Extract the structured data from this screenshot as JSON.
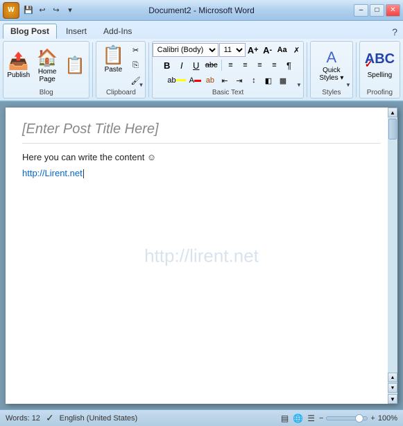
{
  "window": {
    "title": "Document2 - Microsoft Word",
    "min_label": "–",
    "max_label": "□",
    "close_label": "✕"
  },
  "office_btn": {
    "label": "W"
  },
  "quick_access": {
    "save_icon": "💾",
    "undo_icon": "↩",
    "redo_icon": "↪",
    "dropdown_icon": "▾"
  },
  "tabs": [
    {
      "id": "blog-post",
      "label": "Blog Post",
      "active": true
    },
    {
      "id": "insert",
      "label": "Insert",
      "active": false
    },
    {
      "id": "add-ins",
      "label": "Add-Ins",
      "active": false
    }
  ],
  "groups": {
    "blog": {
      "label": "Blog",
      "publish_label": "Publish",
      "home_page_label": "Home\nPage"
    },
    "clipboard": {
      "label": "Clipboard",
      "paste_label": "Paste",
      "cut_icon": "✂",
      "copy_icon": "⎘",
      "format_icon": "⎙"
    },
    "basic_text": {
      "label": "Basic Text",
      "font": "Calibri (Body)",
      "size": "11",
      "bold": "B",
      "italic": "I",
      "underline": "U",
      "strikethrough": "abc",
      "align_left": "≡",
      "align_center": "≡",
      "align_right": "≡",
      "justify": "≡",
      "line_spacing": "↕",
      "indent_decrease": "←",
      "indent_increase": "→",
      "grow_font": "A↑",
      "shrink_font": "A↓",
      "change_case": "Aa",
      "clear_format": "✗",
      "highlight": "ab",
      "font_color": "A",
      "show_hide": "¶"
    },
    "styles": {
      "label": "Styles",
      "quick_styles_label": "Quick\nStyles",
      "dropdown_icon": "▾"
    },
    "proofing": {
      "label": "Proofing",
      "spelling_label": "Spelling"
    }
  },
  "document": {
    "title_placeholder": "[Enter Post Title Here]",
    "content_line": "Here you can write the content ☺",
    "link": "http://Lirent.net",
    "watermark": "http://lirent.net",
    "cursor_pos": "after link"
  },
  "status_bar": {
    "words_label": "Words: 12",
    "language": "English (United States)",
    "zoom": "100%",
    "zoom_value": 100
  }
}
